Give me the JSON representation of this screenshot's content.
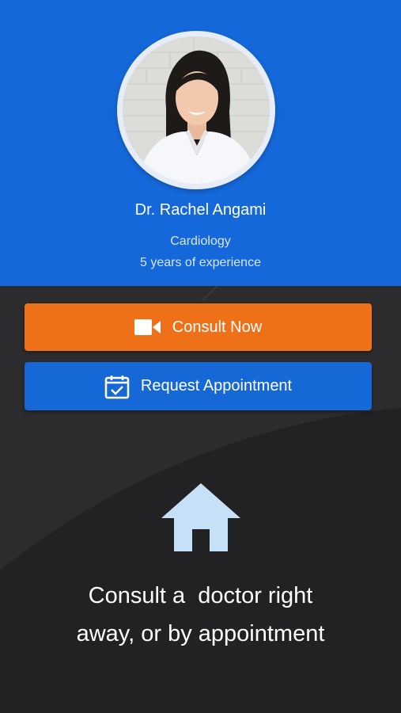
{
  "doctor": {
    "name": "Dr. Rachel Angami",
    "specialty": "Cardiology",
    "experience": "5 years of experience",
    "photo": "doctor-portrait"
  },
  "actions": {
    "consult_label": "Consult Now",
    "consult_icon": "video-camera-icon",
    "request_label": "Request Appointment",
    "request_icon": "calendar-check-icon"
  },
  "promo": {
    "icon": "home-icon",
    "line1": "Consult a  doctor right",
    "line2": "away, or by appointment"
  },
  "colors": {
    "header_blue": "#1568d9",
    "consult_orange": "#ee7119",
    "request_blue": "#1668d6",
    "background_dark": "#2c2c2e",
    "icon_light_blue": "#c5e0f7"
  }
}
